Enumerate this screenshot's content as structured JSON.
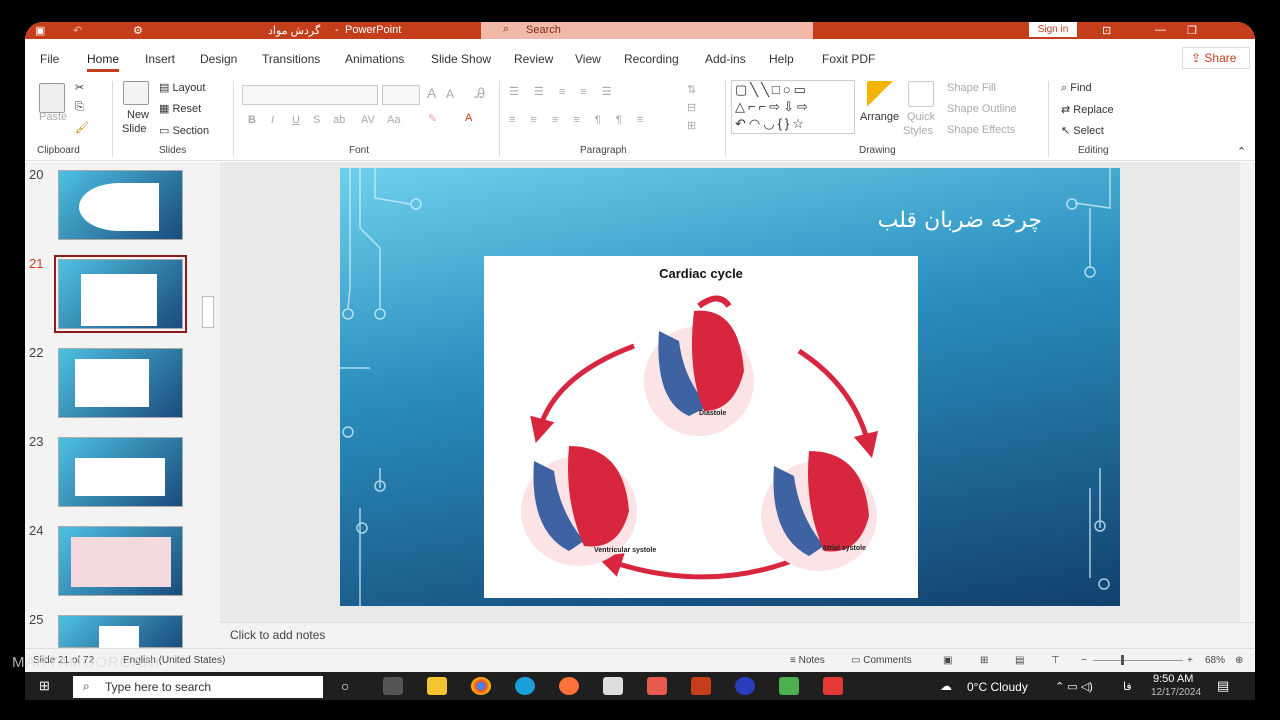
{
  "window": {
    "title": "گردش مواد",
    "app": "PowerPoint",
    "search_placeholder": "Search",
    "sign_in": "Sign in"
  },
  "menu": {
    "tabs": [
      "File",
      "Home",
      "Insert",
      "Design",
      "Transitions",
      "Animations",
      "Slide Show",
      "Review",
      "View",
      "Recording",
      "Add-ins",
      "Help",
      "Foxit PDF"
    ],
    "active": "Home",
    "share": "Share"
  },
  "ribbon": {
    "clipboard": {
      "label": "Clipboard",
      "paste": "Paste"
    },
    "slides": {
      "label": "Slides",
      "new_slide": "New",
      "new_slide2": "Slide",
      "layout": "Layout",
      "reset": "Reset",
      "section": "Section"
    },
    "font": {
      "label": "Font",
      "bold": "B",
      "italic": "I",
      "underline": "U",
      "strike": "S",
      "case": "Aa"
    },
    "paragraph": {
      "label": "Paragraph"
    },
    "drawing": {
      "label": "Drawing",
      "arrange": "Arrange",
      "quick_styles1": "Quick",
      "quick_styles2": "Styles",
      "shape_fill": "Shape Fill",
      "shape_outline": "Shape Outline",
      "shape_effects": "Shape Effects"
    },
    "editing": {
      "label": "Editing",
      "find": "Find",
      "replace": "Replace",
      "select": "Select"
    }
  },
  "thumbnails": {
    "numbers": [
      "20",
      "21",
      "22",
      "23",
      "24",
      "25"
    ],
    "selected": "21"
  },
  "slide": {
    "title": "چرخه ضربان قلب",
    "diagram_title": "Cardiac cycle",
    "phases": {
      "diastole": "Diastole",
      "ventricular": "Ventricular systole",
      "atrial": "Atrial systole"
    }
  },
  "notes": {
    "placeholder": "Click to add notes"
  },
  "status": {
    "slide_info": "Slide 21 of 72",
    "language": "English (United States)",
    "notes": "Notes",
    "comments": "Comments",
    "zoom": "68%"
  },
  "taskbar": {
    "search": "Type here to search",
    "weather": "0°C  Cloudy",
    "lang": "فا",
    "time": "9:50 AM",
    "date": "12/17/2024"
  },
  "watermark": "MARYAMGORGANI",
  "colors": {
    "accent": "#c43e1c",
    "heart_red": "#d7263d",
    "heart_blue": "#3f62a3"
  }
}
